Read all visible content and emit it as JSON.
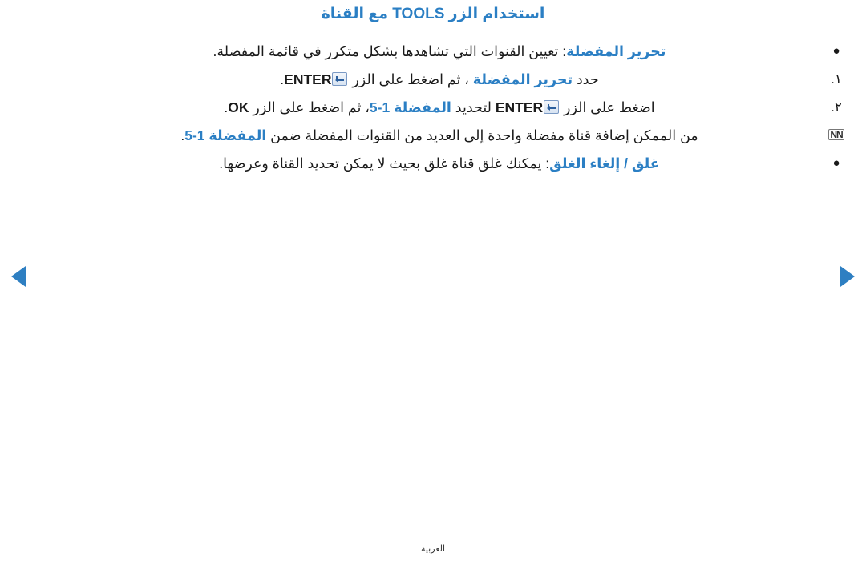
{
  "document": {
    "title_prefix": "استخدام الزر ",
    "title_tools": "TOOLS",
    "title_suffix": " مع القناة",
    "footer": "العربية",
    "accent_color": "#2b7fc4",
    "items": [
      {
        "marker": "●",
        "marker_type": "bullet",
        "highlight": "تحرير المفضلة",
        "text_after": ": تعيين القنوات التي تشاهدها بشكل متكرر في قائمة المفضلة.",
        "text_before": ""
      },
      {
        "marker": "١.",
        "marker_type": "num",
        "text_before": "حدد ",
        "highlight": "تحرير المفضلة",
        "text_mid": " ، ثم اضغط على الزر ",
        "key": "enter-key-icon",
        "bold_after": "ENTER",
        "text_after": "."
      },
      {
        "marker": "٢.",
        "marker_type": "num",
        "text_before": "اضغط على الزر ",
        "key": "enter-key-icon",
        "bold_after": "ENTER",
        "text_mid": " لتحديد ",
        "highlight": "المفضلة 1-5",
        "text_mid2": "، ثم اضغط على الزر ",
        "bold_ok": "OK",
        "text_after": "."
      },
      {
        "marker": "NN",
        "marker_type": "nn",
        "text_before": "من الممكن إضافة قناة مفضلة واحدة إلى العديد من القنوات المفضلة ضمن ",
        "highlight": "المفضلة 1-5",
        "text_after": "."
      },
      {
        "marker": "●",
        "marker_type": "bullet",
        "highlight": "غلق / إلغاء الغلق",
        "text_after": ": يمكنك غلق قناة غلق بحيث لا يمكن تحديد القناة وعرضها."
      }
    ],
    "nav": {
      "prev_label": "prev-page-arrow",
      "next_label": "next-page-arrow"
    }
  }
}
